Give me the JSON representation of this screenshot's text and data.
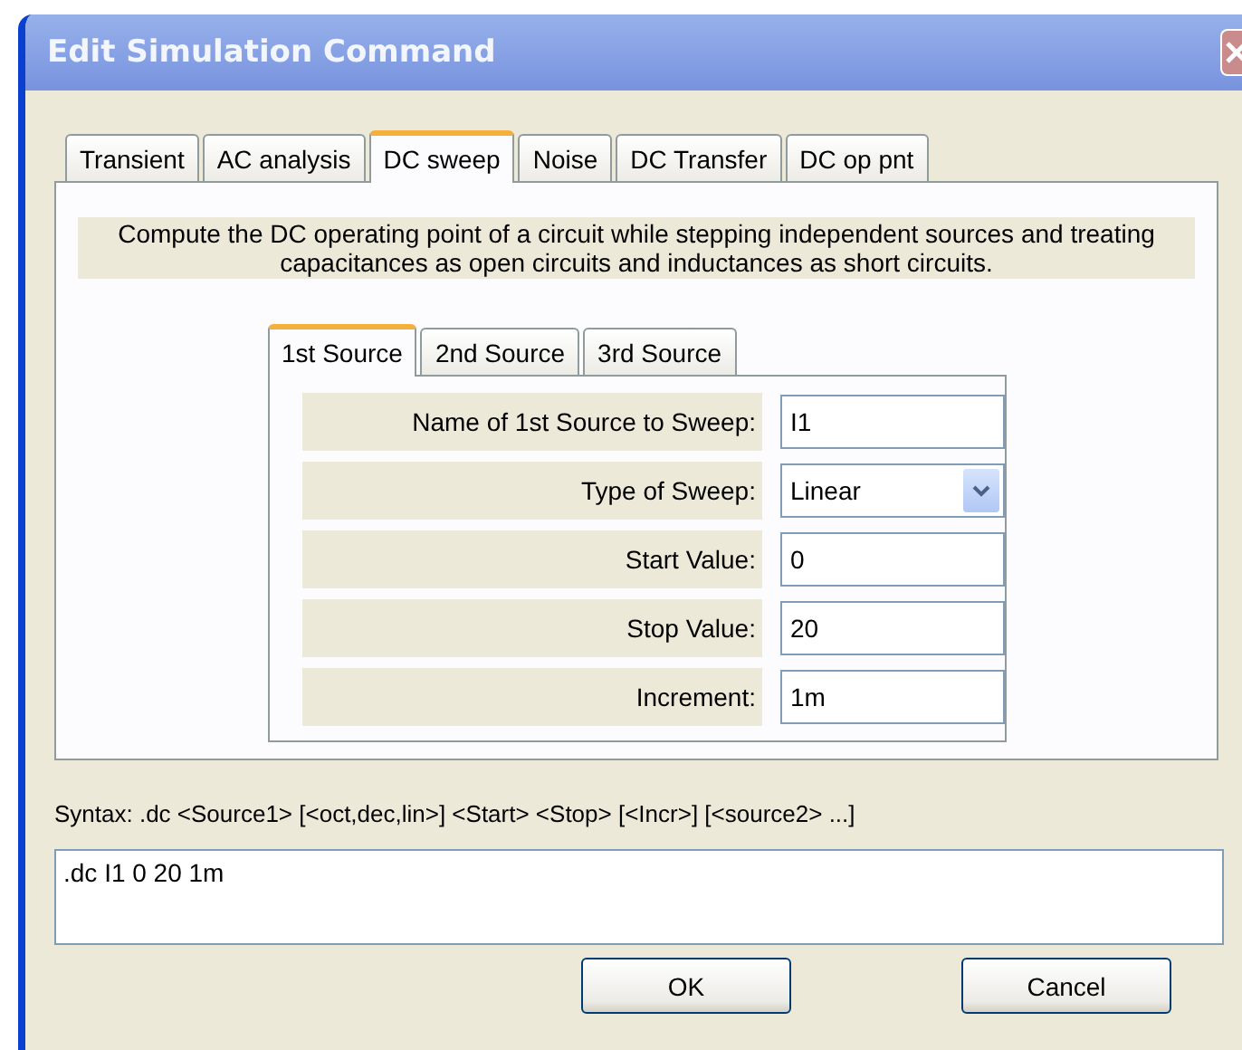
{
  "window": {
    "title": "Edit Simulation Command"
  },
  "tabs": [
    {
      "label": "Transient",
      "selected": false
    },
    {
      "label": "AC analysis",
      "selected": false
    },
    {
      "label": "DC sweep",
      "selected": true
    },
    {
      "label": "Noise",
      "selected": false
    },
    {
      "label": "DC Transfer",
      "selected": false
    },
    {
      "label": "DC op pnt",
      "selected": false
    }
  ],
  "description": "Compute the DC operating point of a circuit while stepping independent sources and treating capacitances as open circuits and inductances as short circuits.",
  "source_tabs": [
    {
      "label": "1st Source",
      "selected": true
    },
    {
      "label": "2nd Source",
      "selected": false
    },
    {
      "label": "3rd Source",
      "selected": false
    }
  ],
  "fields": [
    {
      "kind": "text",
      "label": "Name of 1st Source to Sweep:",
      "value": "I1"
    },
    {
      "kind": "select",
      "label": "Type of Sweep:",
      "value": "Linear"
    },
    {
      "kind": "text",
      "label": "Start Value:",
      "value": "0"
    },
    {
      "kind": "text",
      "label": "Stop Value:",
      "value": "20"
    },
    {
      "kind": "text",
      "label": "Increment:",
      "value": "1m"
    }
  ],
  "syntax": "Syntax:  .dc <Source1> [<oct,dec,lin>] <Start> <Stop> [<Incr>] [<source2> ...]",
  "command": ".dc I1 0 20 1m",
  "buttons": [
    "OK",
    "Cancel"
  ]
}
